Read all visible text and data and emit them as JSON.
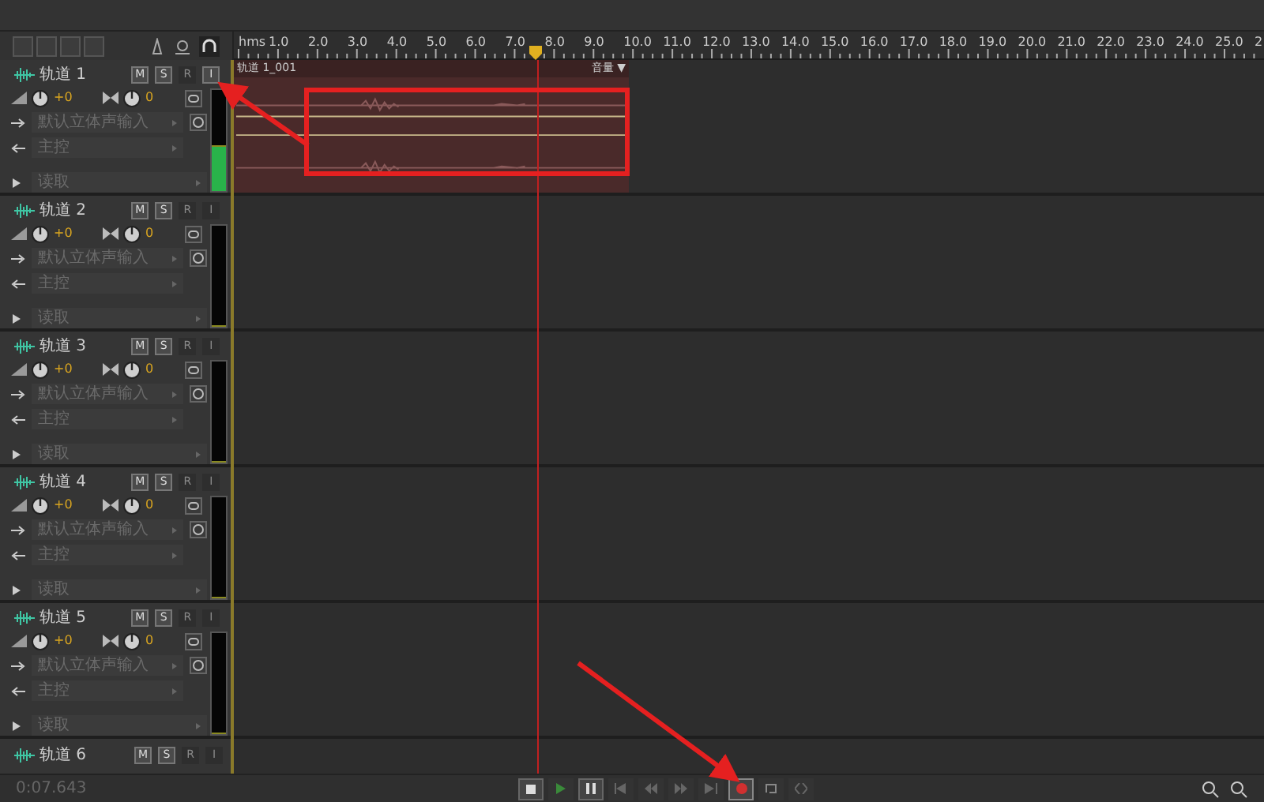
{
  "ruler": {
    "unit": "hms",
    "labels": [
      "1.0",
      "2.0",
      "3.0",
      "4.0",
      "5.0",
      "6.0",
      "7.0",
      "8.0",
      "9.0",
      "10.0",
      "11.0",
      "12.0",
      "13.0",
      "14.0",
      "15.0",
      "16.0",
      "17.0",
      "18.0",
      "19.0",
      "20.0",
      "21.0",
      "22.0",
      "23.0",
      "24.0",
      "25.0",
      "2"
    ]
  },
  "tracks": [
    {
      "name": "轨道 1",
      "buttons": [
        {
          "label": "M",
          "disabled": false
        },
        {
          "label": "S",
          "disabled": false
        },
        {
          "label": "R",
          "disabled": true
        },
        {
          "label": "I",
          "disabled": false
        }
      ],
      "volume": "+0",
      "pan": "0",
      "input": "默认立体声输入",
      "output": "主控",
      "automation": "读取",
      "level": 0.45
    },
    {
      "name": "轨道 2",
      "buttons": [
        {
          "label": "M",
          "disabled": false
        },
        {
          "label": "S",
          "disabled": false
        },
        {
          "label": "R",
          "disabled": true
        },
        {
          "label": "I",
          "disabled": true
        }
      ],
      "volume": "+0",
      "pan": "0",
      "input": "默认立体声输入",
      "output": "主控",
      "automation": "读取",
      "level": 0
    },
    {
      "name": "轨道 3",
      "buttons": [
        {
          "label": "M",
          "disabled": false
        },
        {
          "label": "S",
          "disabled": false
        },
        {
          "label": "R",
          "disabled": true
        },
        {
          "label": "I",
          "disabled": true
        }
      ],
      "volume": "+0",
      "pan": "0",
      "input": "默认立体声输入",
      "output": "主控",
      "automation": "读取",
      "level": 0
    },
    {
      "name": "轨道 4",
      "buttons": [
        {
          "label": "M",
          "disabled": false
        },
        {
          "label": "S",
          "disabled": false
        },
        {
          "label": "R",
          "disabled": true
        },
        {
          "label": "I",
          "disabled": true
        }
      ],
      "volume": "+0",
      "pan": "0",
      "input": "默认立体声输入",
      "output": "主控",
      "automation": "读取",
      "level": 0
    },
    {
      "name": "轨道 5",
      "buttons": [
        {
          "label": "M",
          "disabled": false
        },
        {
          "label": "S",
          "disabled": false
        },
        {
          "label": "R",
          "disabled": true
        },
        {
          "label": "I",
          "disabled": true
        }
      ],
      "volume": "+0",
      "pan": "0",
      "input": "默认立体声输入",
      "output": "主控",
      "automation": "读取",
      "level": 0
    },
    {
      "name": "轨道 6",
      "buttons": [
        {
          "label": "M",
          "disabled": false
        },
        {
          "label": "S",
          "disabled": false
        },
        {
          "label": "R",
          "disabled": true
        },
        {
          "label": "I",
          "disabled": true
        }
      ]
    }
  ],
  "clip": {
    "name": "轨道 1_001",
    "envelope": "音量",
    "menu": "▼"
  },
  "transport": {
    "time": "0:07.643",
    "record_on": true
  }
}
